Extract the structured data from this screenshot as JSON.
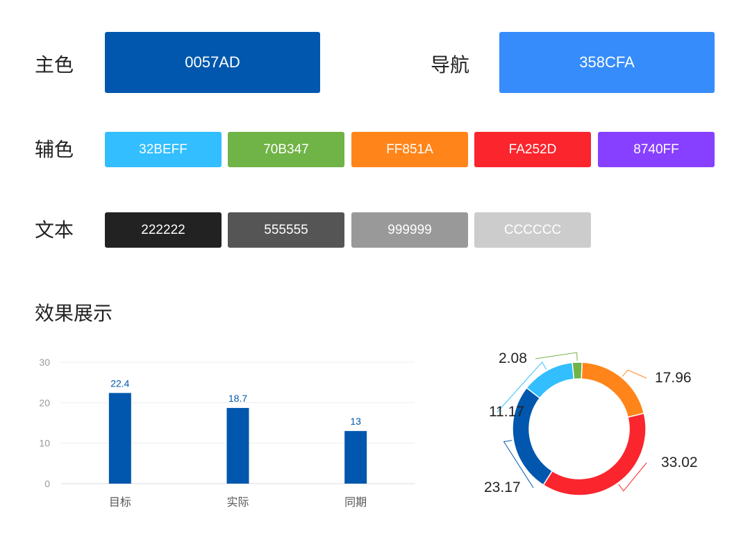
{
  "primary": {
    "label": "主色",
    "swatch": {
      "hex": "0057AD",
      "color": "#0057AD"
    }
  },
  "nav": {
    "label": "导航",
    "swatch": {
      "hex": "358CFA",
      "color": "#358CFA"
    }
  },
  "secondary": {
    "label": "辅色",
    "swatches": [
      {
        "hex": "32BEFF",
        "color": "#32BEFF"
      },
      {
        "hex": "70B347",
        "color": "#70B347"
      },
      {
        "hex": "FF851A",
        "color": "#FF851A"
      },
      {
        "hex": "FA252D",
        "color": "#FA252D"
      },
      {
        "hex": "8740FF",
        "color": "#8740FF"
      }
    ]
  },
  "text": {
    "label": "文本",
    "swatches": [
      {
        "hex": "222222",
        "color": "#222222"
      },
      {
        "hex": "555555",
        "color": "#555555"
      },
      {
        "hex": "999999",
        "color": "#999999"
      },
      {
        "hex": "CCCCCC",
        "color": "#CCCCCC"
      }
    ]
  },
  "section_title": "效果展示",
  "chart_data": [
    {
      "type": "bar",
      "categories": [
        "目标",
        "实际",
        "同期"
      ],
      "values": [
        22.4,
        18.7,
        13
      ],
      "ylim": [
        0,
        30
      ],
      "yticks": [
        0,
        10,
        20,
        30
      ],
      "color": "#0057AD",
      "grid": true
    },
    {
      "type": "pie",
      "donut": true,
      "slices": [
        {
          "value": 2.08,
          "color": "#70B347"
        },
        {
          "value": 17.96,
          "color": "#FF851A"
        },
        {
          "value": 33.02,
          "color": "#FA252D"
        },
        {
          "value": 23.17,
          "color": "#0057AD"
        },
        {
          "value": 11.17,
          "color": "#32BEFF"
        }
      ]
    }
  ]
}
